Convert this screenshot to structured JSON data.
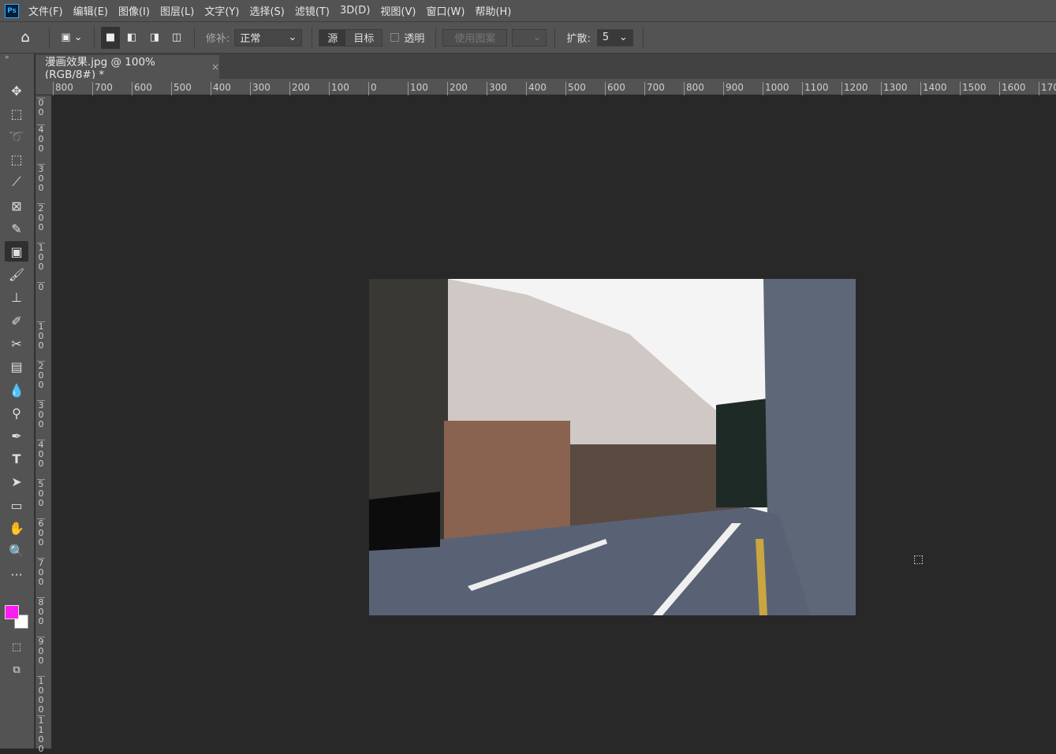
{
  "app": {
    "logo": "Ps"
  },
  "menu": [
    "文件(F)",
    "编辑(E)",
    "图像(I)",
    "图层(L)",
    "文字(Y)",
    "选择(S)",
    "滤镜(T)",
    "3D(D)",
    "视图(V)",
    "窗口(W)",
    "帮助(H)"
  ],
  "options": {
    "patch_label": "修补:",
    "patch_value": "正常",
    "source": "源",
    "target": "目标",
    "transparent": "透明",
    "use_pattern": "使用图案",
    "diffusion_label": "扩散:",
    "diffusion_value": "5"
  },
  "document": {
    "tab_title": "漫画效果.jpg @ 100%(RGB/8#) *",
    "close": "×"
  },
  "ruler": {
    "horizontal": [
      "800",
      "700",
      "600",
      "500",
      "400",
      "300",
      "200",
      "100",
      "0",
      "100",
      "200",
      "300",
      "400",
      "500",
      "600",
      "700",
      "800",
      "900",
      "1000",
      "1100",
      "1200",
      "1300",
      "1400",
      "1500",
      "1600",
      "170"
    ],
    "vertical": [
      "00",
      "400",
      "300",
      "200",
      "100",
      "0",
      "100",
      "200",
      "300",
      "400",
      "500",
      "600",
      "700",
      "800",
      "900",
      "1000",
      "1100"
    ]
  },
  "colors": {
    "foreground": "#ff1cf0",
    "background": "#ffffff"
  }
}
